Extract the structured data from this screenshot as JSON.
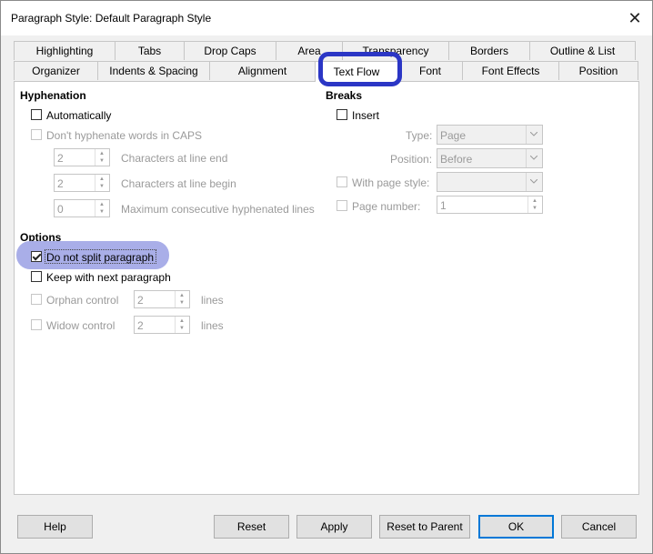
{
  "window": {
    "title": "Paragraph Style: Default Paragraph Style",
    "close_glyph": "✕"
  },
  "tabs_top": [
    {
      "label": "Highlighting"
    },
    {
      "label": "Tabs"
    },
    {
      "label": "Drop Caps"
    },
    {
      "label": "Area"
    },
    {
      "label": "Transparency"
    },
    {
      "label": "Borders"
    },
    {
      "label": "Outline & List"
    }
  ],
  "tabs_bottom": [
    {
      "label": "Organizer"
    },
    {
      "label": "Indents & Spacing"
    },
    {
      "label": "Alignment"
    },
    {
      "label": "Text Flow"
    },
    {
      "label": "Font"
    },
    {
      "label": "Font Effects"
    },
    {
      "label": "Position"
    }
  ],
  "active_tab": "Text Flow",
  "hyphenation": {
    "title": "Hyphenation",
    "automatically": {
      "label": "Automatically",
      "checked": false
    },
    "dont_hyphenate_caps": {
      "label": "Don't hyphenate words in CAPS",
      "checked": false
    },
    "chars_line_end": {
      "value": "2",
      "label": "Characters at line end"
    },
    "chars_line_begin": {
      "value": "2",
      "label": "Characters at line begin"
    },
    "max_consecutive": {
      "value": "0",
      "label": "Maximum consecutive hyphenated lines"
    }
  },
  "breaks": {
    "title": "Breaks",
    "insert": {
      "label": "Insert",
      "checked": false
    },
    "type": {
      "label": "Type:",
      "value": "Page"
    },
    "position": {
      "label": "Position:",
      "value": "Before"
    },
    "with_page_style": {
      "label": "With page style:",
      "value": ""
    },
    "page_number": {
      "label": "Page number:",
      "value": "1"
    }
  },
  "options": {
    "title": "Options",
    "do_not_split": {
      "label": "Do not split paragraph",
      "checked": true
    },
    "keep_with_next": {
      "label": "Keep with next paragraph",
      "checked": false
    },
    "orphan": {
      "label": "Orphan control",
      "value": "2",
      "unit": "lines"
    },
    "widow": {
      "label": "Widow control",
      "value": "2",
      "unit": "lines"
    }
  },
  "buttons": {
    "help": "Help",
    "reset": "Reset",
    "apply": "Apply",
    "reset_to_parent": "Reset to Parent",
    "ok": "OK",
    "cancel": "Cancel"
  },
  "colors": {
    "highlight_outline": "#2b36c5",
    "highlight_fill": "#a9aee8",
    "ok_border": "#0078d7"
  }
}
